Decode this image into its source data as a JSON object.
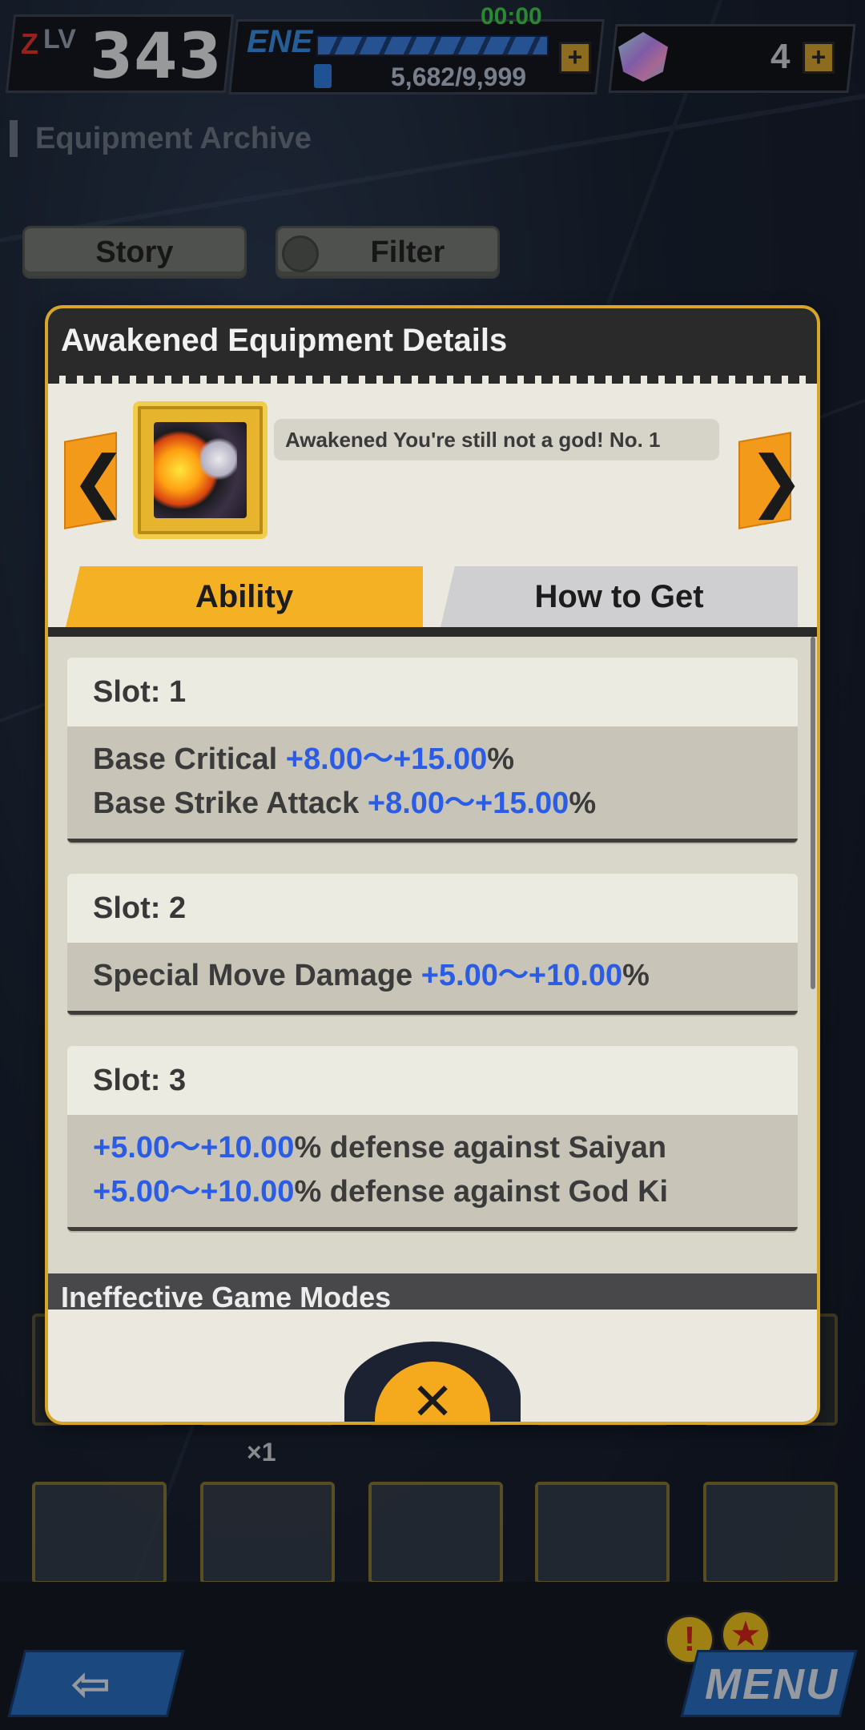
{
  "status": {
    "rank_prefix_z": "Z",
    "rank_prefix_lv": "LV",
    "rank_value": "343",
    "energy_label": "ENE",
    "energy_value": "5,682/9,999",
    "timer": "00:00",
    "gem_count": "4",
    "plus_symbol": "+"
  },
  "page": {
    "title": "Equipment Archive",
    "story_button": "Story",
    "filter_button": "Filter",
    "card_multiplier": "×1"
  },
  "modal": {
    "title": "Awakened Equipment Details",
    "equipment_name": "Awakened You're still not a god! No. 1",
    "prev_glyph": "❮",
    "next_glyph": "❯",
    "tabs": [
      {
        "label": "Ability",
        "active": true
      },
      {
        "label": "How to Get",
        "active": false
      }
    ],
    "slots": [
      {
        "header": "Slot: 1",
        "lines": [
          {
            "pre": "Base Critical ",
            "range": "+8.00～+15.00",
            "post": "%"
          },
          {
            "pre": "Base Strike Attack ",
            "range": "+8.00～+15.00",
            "post": "%"
          }
        ]
      },
      {
        "header": "Slot: 2",
        "lines": [
          {
            "pre": "Special Move Damage ",
            "range": "+5.00～+10.00",
            "post": "%"
          }
        ]
      },
      {
        "header": "Slot: 3",
        "lines": [
          {
            "pre": "",
            "range": "+5.00～+10.00",
            "post": "% defense against Saiyan"
          },
          {
            "pre": "",
            "range": "+5.00～+10.00",
            "post": "% defense against God Ki"
          }
        ]
      }
    ],
    "ineffective_label": "Ineffective Game Modes",
    "close_glyph": "✕"
  },
  "nav": {
    "back_glyph": "⇦",
    "menu_label": "MENU",
    "alert_glyph": "!",
    "event_glyph": "★"
  },
  "colors": {
    "accent_orange": "#f4b124",
    "value_blue": "#2a5ce6",
    "nav_blue": "#2a70c4"
  }
}
